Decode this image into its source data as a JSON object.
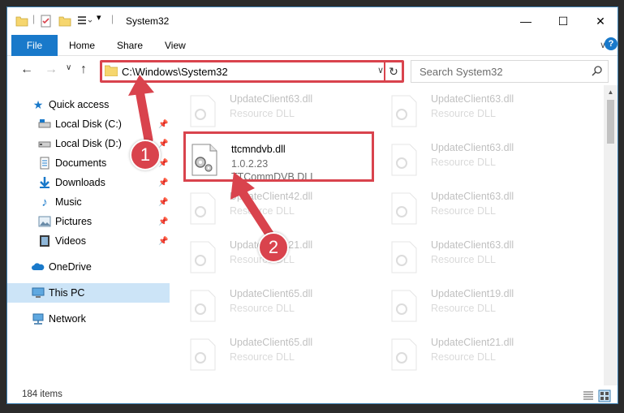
{
  "window": {
    "title": "System32",
    "controls": {
      "minimize": "—",
      "maximize": "☐",
      "close": "✕"
    }
  },
  "ribbon": {
    "file": "File",
    "tabs": [
      "Home",
      "Share",
      "View"
    ],
    "expand": "∨",
    "help": "?"
  },
  "address": {
    "path": "C:\\Windows\\System32",
    "search_placeholder": "Search System32"
  },
  "sidebar": {
    "items": [
      {
        "label": "Quick access",
        "icon": "star-icon"
      },
      {
        "label": "Local Disk (C:)",
        "icon": "drive-icon",
        "pinned": true
      },
      {
        "label": "Local Disk (D:)",
        "icon": "drive-icon",
        "pinned": true
      },
      {
        "label": "Documents",
        "icon": "documents-icon",
        "pinned": true
      },
      {
        "label": "Downloads",
        "icon": "downloads-icon",
        "pinned": true
      },
      {
        "label": "Music",
        "icon": "music-icon",
        "pinned": true
      },
      {
        "label": "Pictures",
        "icon": "pictures-icon",
        "pinned": true
      },
      {
        "label": "Videos",
        "icon": "videos-icon",
        "pinned": true
      },
      {
        "label": "OneDrive",
        "icon": "cloud-icon"
      },
      {
        "label": "This PC",
        "icon": "computer-icon",
        "selected": true
      },
      {
        "label": "Network",
        "icon": "network-icon"
      }
    ]
  },
  "files": {
    "selected": {
      "name": "ttcmndvb.dll",
      "version": "1.0.2.23",
      "description": "TTCommDVB DLL"
    },
    "col1": [
      {
        "name": "UpdateClient63.dll",
        "type": "Resource DLL"
      },
      {
        "name": "UpdateClient42.dll",
        "type": "Resource DLL"
      },
      {
        "name": "UpdateClient21.dll",
        "type": "Resource DLL"
      },
      {
        "name": "UpdateClient65.dll",
        "type": "Resource DLL"
      },
      {
        "name": "UpdateClient65.dll",
        "type": "Resource DLL"
      }
    ],
    "col2": [
      {
        "name": "UpdateClient63.dll",
        "type": "Resource DLL"
      },
      {
        "name": "UpdateClient63.dll",
        "type": "Resource DLL"
      },
      {
        "name": "UpdateClient63.dll",
        "type": "Resource DLL"
      },
      {
        "name": "UpdateClient63.dll",
        "type": "Resource DLL"
      },
      {
        "name": "UpdateClient19.dll",
        "type": "Resource DLL"
      },
      {
        "name": "UpdateClient21.dll",
        "type": "Resource DLL"
      }
    ]
  },
  "status": {
    "items": "184 items"
  },
  "annotations": {
    "step1": "1",
    "step2": "2"
  },
  "colors": {
    "accent": "#1979ca",
    "highlight": "#d9434d",
    "selected": "#cce4f7"
  }
}
